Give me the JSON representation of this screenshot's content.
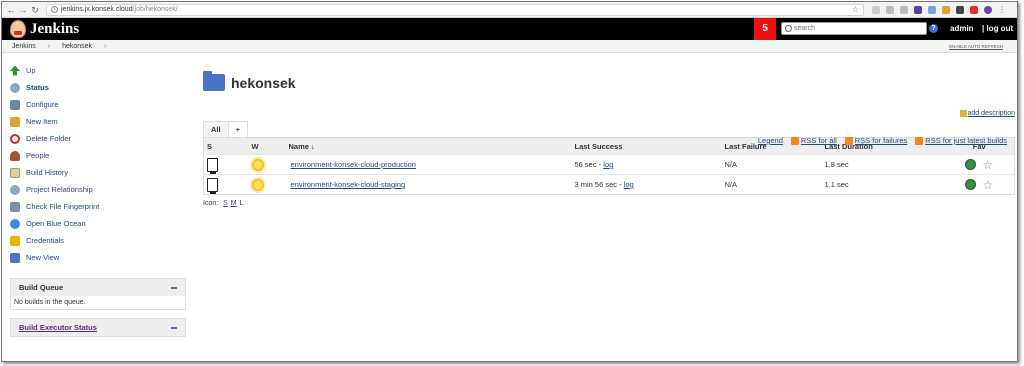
{
  "browser": {
    "url_host": "jenkins.jx.konsek.cloud",
    "url_path": "/job/hekonsek/"
  },
  "header": {
    "app_name": "Jenkins",
    "notification_count": "5",
    "search_placeholder": "search",
    "help_label": "?",
    "user": "admin",
    "logout": "| log out"
  },
  "breadcrumb": {
    "items": [
      "Jenkins",
      "hekonsek"
    ],
    "auto_refresh": "ENABLE AUTO REFRESH"
  },
  "sidebar": {
    "tasks": [
      {
        "label": "Up",
        "icon": "up-arrow-icon",
        "color": "#2e9b2e"
      },
      {
        "label": "Status",
        "icon": "magnifier-icon",
        "color": "#8aa6c9"
      },
      {
        "label": "Configure",
        "icon": "wrench-screwdriver-icon",
        "color": "#6f86a3"
      },
      {
        "label": "New Item",
        "icon": "new-item-folder-icon",
        "color": "#d9a33b"
      },
      {
        "label": "Delete Folder",
        "icon": "no-entry-icon",
        "color": "#d22"
      },
      {
        "label": "People",
        "icon": "people-icon",
        "color": "#a3552a"
      },
      {
        "label": "Build History",
        "icon": "notepad-icon",
        "color": "#e3d08a"
      },
      {
        "label": "Project Relationship",
        "icon": "magnifier-icon",
        "color": "#8aa6c9"
      },
      {
        "label": "Check File Fingerprint",
        "icon": "fingerprint-icon",
        "color": "#7e8fa3"
      },
      {
        "label": "Open Blue Ocean",
        "icon": "blue-ocean-icon",
        "color": "#3f8ad8"
      },
      {
        "label": "Credentials",
        "icon": "credentials-icon",
        "color": "#f0b000"
      },
      {
        "label": "New View",
        "icon": "folder-icon",
        "color": "#4a74c5"
      }
    ],
    "build_queue": {
      "title": "Build Queue",
      "empty": "No builds in the queue."
    },
    "executor_status": {
      "title": "Build Executor Status"
    }
  },
  "main": {
    "title": "hekonsek",
    "add_description": "add description",
    "tabs": [
      "All",
      "+"
    ],
    "columns": [
      "S",
      "W",
      "Name ↓",
      "Last Success",
      "Last Failure",
      "Last Duration",
      "Fav"
    ],
    "rows": [
      {
        "name": "environment-konsek-cloud-production",
        "last_success": "56 sec -",
        "log": "log",
        "last_failure": "N/A",
        "last_duration": "1.8 sec"
      },
      {
        "name": "environment-konsek-cloud-staging",
        "last_success": "3 min 56 sec -",
        "log": "log",
        "last_failure": "N/A",
        "last_duration": "1.1 sec"
      }
    ],
    "icon_label": "Icon:",
    "icon_sizes": [
      "S",
      "M",
      "L"
    ],
    "legend": "Legend",
    "feeds": [
      "RSS for all",
      "RSS for failures",
      "RSS for just latest builds"
    ]
  }
}
